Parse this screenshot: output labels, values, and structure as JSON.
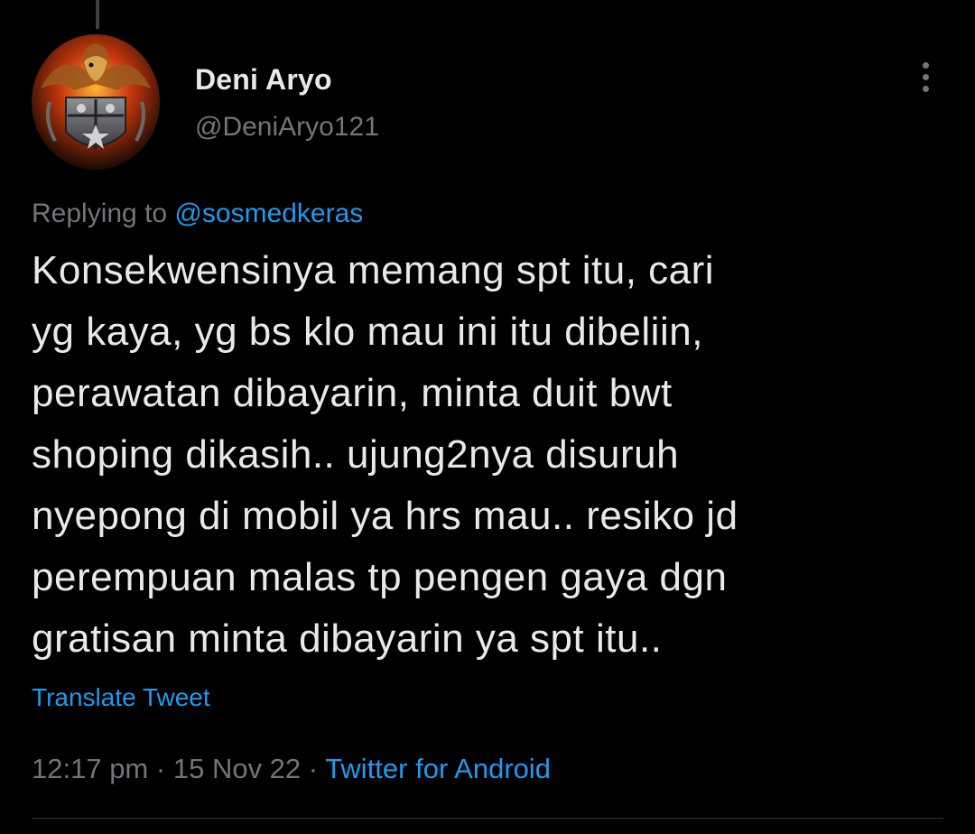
{
  "author": {
    "display_name": "Deni Aryo",
    "handle": "@DeniAryo121"
  },
  "reply": {
    "prefix": "Replying to",
    "mention": "@sosmedkeras"
  },
  "tweet": {
    "text": "Konsekwensinya memang spt itu, cari\nyg kaya, yg bs klo mau ini itu dibeliin,\nperawatan dibayarin, minta duit bwt\nshoping dikasih.. ujung2nya disuruh\nnyepong di mobil ya hrs mau.. resiko jd\nperempuan malas tp pengen gaya dgn\ngratisan minta dibayarin ya spt itu..",
    "translate_label": "Translate Tweet"
  },
  "meta": {
    "time": "12:17 pm",
    "separator": "·",
    "date": "15 Nov 22",
    "source": "Twitter for Android"
  },
  "icons": {
    "more": "more-vertical-icon",
    "avatar": "eagle-shield-avatar"
  },
  "colors": {
    "background": "#000000",
    "primary_text": "#e7e9ea",
    "secondary_text": "#71767b",
    "accent": "#1d9bf0"
  }
}
